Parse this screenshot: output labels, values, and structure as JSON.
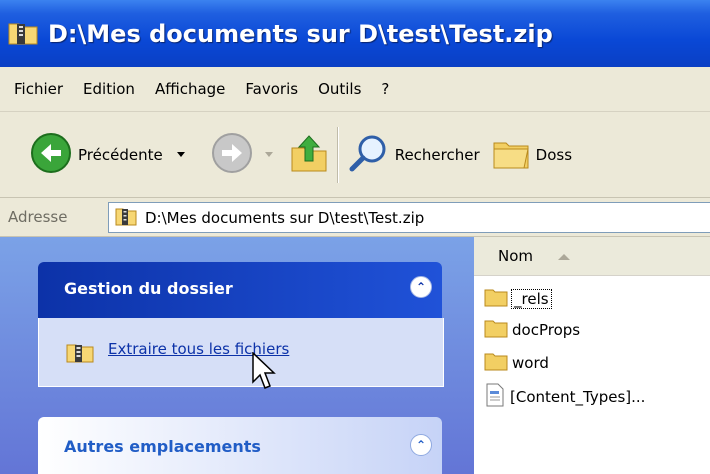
{
  "window": {
    "title": "D:\\Mes documents sur D\\test\\Test.zip"
  },
  "menu": [
    "Fichier",
    "Edition",
    "Affichage",
    "Favoris",
    "Outils",
    "?"
  ],
  "toolbar": {
    "back_label": "Précédente",
    "search_label": "Rechercher",
    "folders_label": "Doss"
  },
  "address": {
    "label": "Adresse",
    "value": "D:\\Mes documents sur D\\test\\Test.zip"
  },
  "taskpane": {
    "folder_tasks_title": "Gestion du dossier",
    "extract_link": "Extraire tous les fichiers",
    "other_places_title": "Autres emplacements"
  },
  "filelist": {
    "column_name": "Nom",
    "items": [
      {
        "name": "_rels",
        "type": "folder"
      },
      {
        "name": "docProps",
        "type": "folder"
      },
      {
        "name": "word",
        "type": "folder"
      },
      {
        "name": "[Content_Types]...",
        "type": "file"
      }
    ]
  },
  "colors": {
    "titlebar": "#0a48d6",
    "taskpane_bg": "#7ba2e7",
    "link": "#0c32a8",
    "chrome": "#ece9d8"
  }
}
